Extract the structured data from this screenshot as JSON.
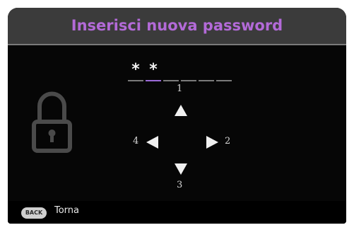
{
  "dialog": {
    "title": "Inserisci nuova password",
    "title_color": "#b36ad8"
  },
  "password": {
    "slots": [
      "*",
      "*",
      "",
      "",
      "",
      ""
    ],
    "active_index": 1
  },
  "keypad": {
    "up_number": "1",
    "right_number": "2",
    "down_number": "3",
    "left_number": "4"
  },
  "footer": {
    "back_button_label": "BACK",
    "back_action_label": "Torna"
  },
  "icons": {
    "lock": "lock-icon",
    "up": "arrow-up-icon",
    "down": "arrow-down-icon",
    "left": "arrow-left-icon",
    "right": "arrow-right-icon"
  }
}
